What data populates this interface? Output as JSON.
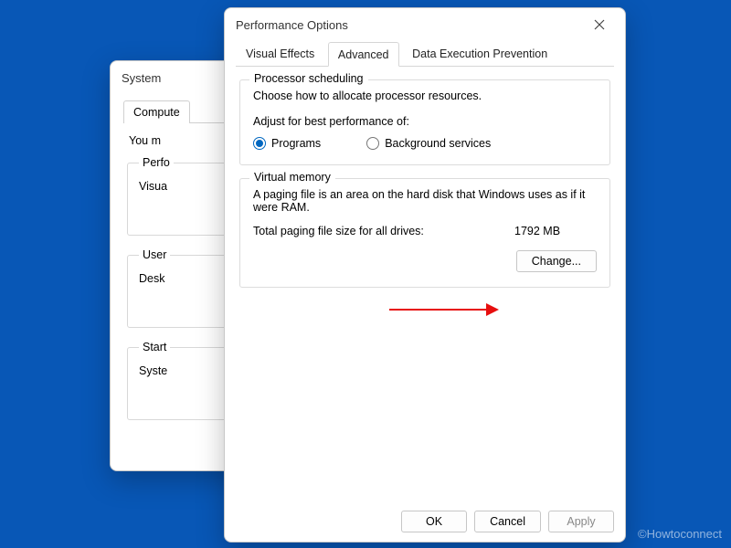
{
  "back_window": {
    "title": "System",
    "tab": "Compute",
    "hint": "You m",
    "group1": {
      "legend": "Perfo",
      "line1": "Visua"
    },
    "group2": {
      "legend": "User",
      "line1": "Desk"
    },
    "group3": {
      "legend": "Start",
      "line1": "Syste"
    }
  },
  "front_window": {
    "title": "Performance Options",
    "tabs": [
      "Visual Effects",
      "Advanced",
      "Data Execution Prevention"
    ],
    "active_tab": 1,
    "proc": {
      "legend": "Processor scheduling",
      "desc": "Choose how to allocate processor resources.",
      "subhead": "Adjust for best performance of:",
      "radios": [
        {
          "label": "Programs",
          "selected": true
        },
        {
          "label": "Background services",
          "selected": false
        }
      ]
    },
    "vm": {
      "legend": "Virtual memory",
      "desc": "A paging file is an area on the hard disk that Windows uses as if it were RAM.",
      "total_label": "Total paging file size for all drives:",
      "total_value": "1792 MB",
      "change_btn": "Change..."
    },
    "buttons": {
      "ok": "OK",
      "cancel": "Cancel",
      "apply": "Apply"
    }
  },
  "watermark": "©Howtoconnect"
}
